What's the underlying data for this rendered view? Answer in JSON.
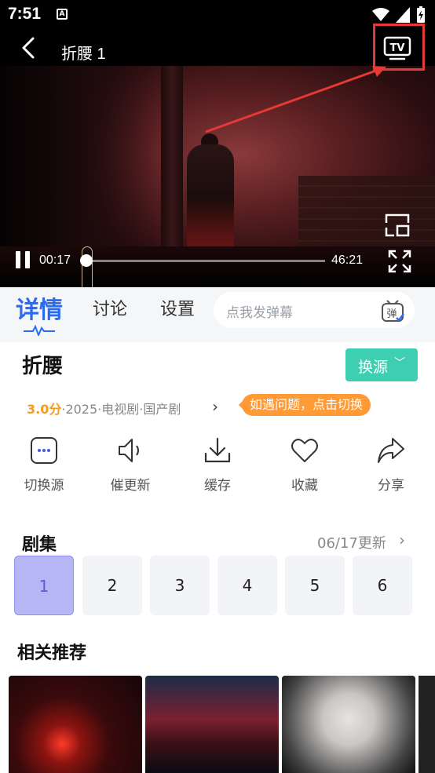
{
  "status_bar": {
    "time": "7:51",
    "notif_icon_letter": "A"
  },
  "header": {
    "title": "折腰 1"
  },
  "player": {
    "current_time": "00:17",
    "total_time": "46:21",
    "progress_fraction": 0.006
  },
  "tabs": [
    {
      "label": "详情",
      "active": true
    },
    {
      "label": "讨论",
      "active": false
    },
    {
      "label": "设置",
      "active": false
    }
  ],
  "danmu": {
    "placeholder": "点我发弹幕",
    "icon_label": "弹"
  },
  "show": {
    "title": "折腰",
    "switch_source_label": "换源",
    "score": "3.0分",
    "meta": "·2025·电视剧·国产剧",
    "tip": "如遇问题，点击切换"
  },
  "actions": [
    {
      "label": "切换源",
      "icon": "more-dots-icon"
    },
    {
      "label": "催更新",
      "icon": "speaker-icon"
    },
    {
      "label": "缓存",
      "icon": "download-icon"
    },
    {
      "label": "收藏",
      "icon": "heart-icon"
    },
    {
      "label": "分享",
      "icon": "share-icon"
    }
  ],
  "episodes": {
    "title": "剧集",
    "update_text": "06/17更新",
    "items": [
      "1",
      "2",
      "3",
      "4",
      "5",
      "6"
    ],
    "active_index": 0
  },
  "recommendations": {
    "title": "相关推荐"
  },
  "colors": {
    "accent_blue": "#2b6af2",
    "switch_source_bg": "#3ecfb2",
    "score_orange": "#f59a23",
    "tip_orange": "#ff9a35",
    "highlight_red": "#e53935",
    "active_episode_bg": "#b7b6f5"
  }
}
